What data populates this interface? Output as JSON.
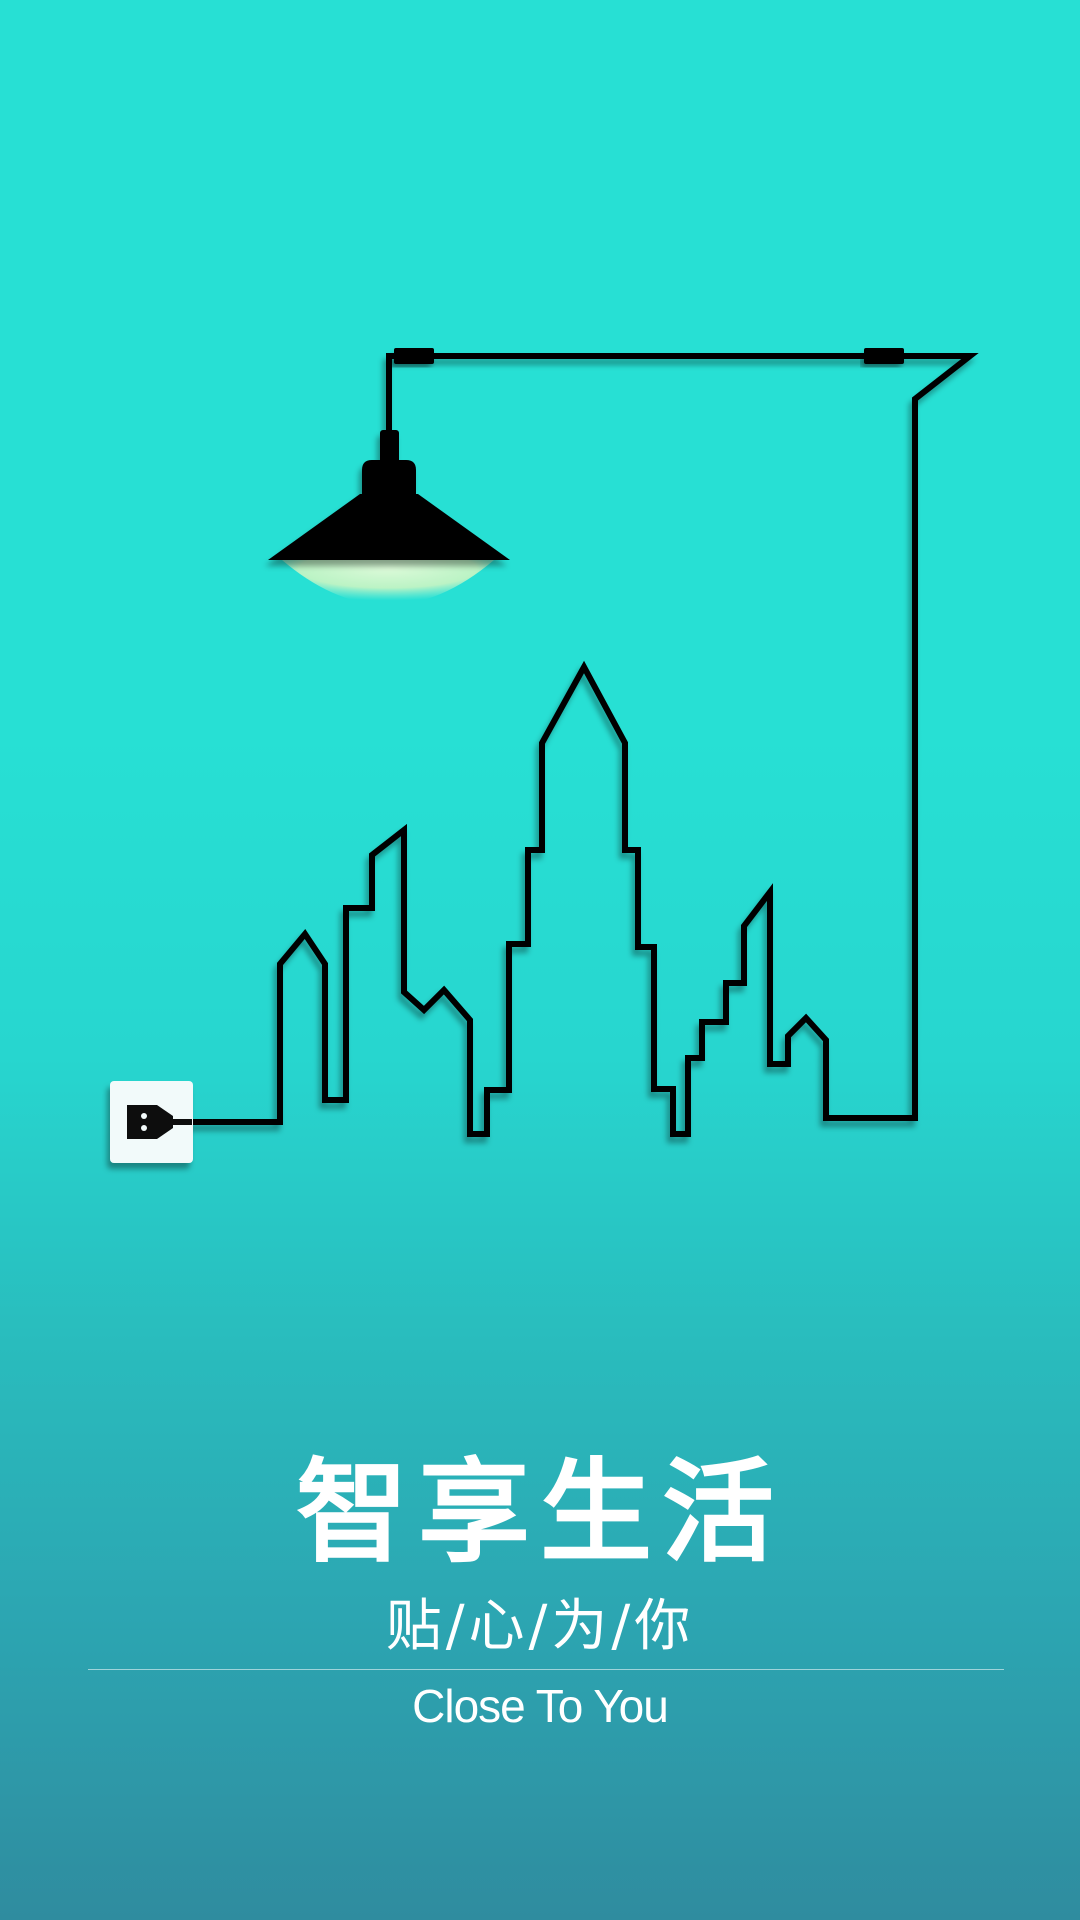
{
  "poster": {
    "title": "智享生活",
    "subtitle": "贴/心/为/你",
    "tagline": "Close To You"
  },
  "icons": {
    "lamp": "pendant-lamp-icon",
    "socket": "wall-socket-icon",
    "plug": "plug-icon",
    "skyline": "city-skyline-icon"
  },
  "colors": {
    "background_top": "#27e0d4",
    "background_bottom": "#2f8c9f",
    "line": "#000000",
    "lamp_glow": "#c8f5c0",
    "text": "#ffffff"
  }
}
